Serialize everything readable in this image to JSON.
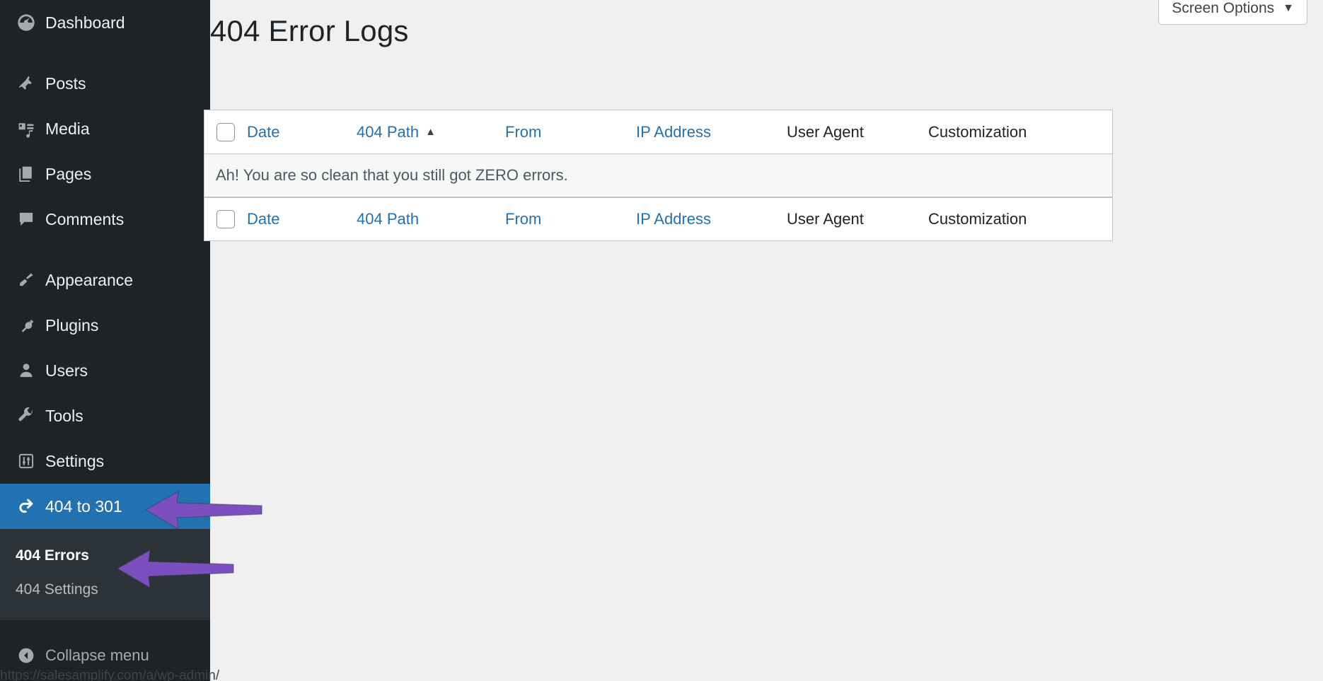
{
  "sidebar": {
    "items": [
      {
        "label": "Dashboard",
        "icon": "dashboard-icon"
      },
      {
        "label": "Posts",
        "icon": "pin-icon"
      },
      {
        "label": "Media",
        "icon": "media-icon"
      },
      {
        "label": "Pages",
        "icon": "pages-icon"
      },
      {
        "label": "Comments",
        "icon": "comments-icon"
      },
      {
        "label": "Appearance",
        "icon": "brush-icon"
      },
      {
        "label": "Plugins",
        "icon": "plug-icon"
      },
      {
        "label": "Users",
        "icon": "user-icon"
      },
      {
        "label": "Tools",
        "icon": "wrench-icon"
      },
      {
        "label": "Settings",
        "icon": "sliders-icon"
      },
      {
        "label": "404 to 301",
        "icon": "redo-icon"
      }
    ],
    "submenu": [
      {
        "label": "404 Errors"
      },
      {
        "label": "404 Settings"
      }
    ],
    "collapse_label": "Collapse menu",
    "highlight_color": "#2271b1"
  },
  "header": {
    "page_title": "404 Error Logs",
    "screen_options_label": "Screen Options",
    "screen_options_caret": "▼"
  },
  "table": {
    "columns": [
      {
        "label": "Date",
        "sortable": true
      },
      {
        "label": "404 Path",
        "sortable": true
      },
      {
        "label": "From",
        "sortable": true
      },
      {
        "label": "IP Address",
        "sortable": true
      },
      {
        "label": "User Agent",
        "sortable": false
      },
      {
        "label": "Customization",
        "sortable": false
      }
    ],
    "sort_indicator": "▲",
    "empty_message": "Ah! You are so clean that you still got ZERO errors."
  },
  "statusbar": {
    "url": "https://salesamplify.com/a/wp-admin/"
  },
  "annotations": {
    "arrow_color": "#7B4FC0"
  }
}
